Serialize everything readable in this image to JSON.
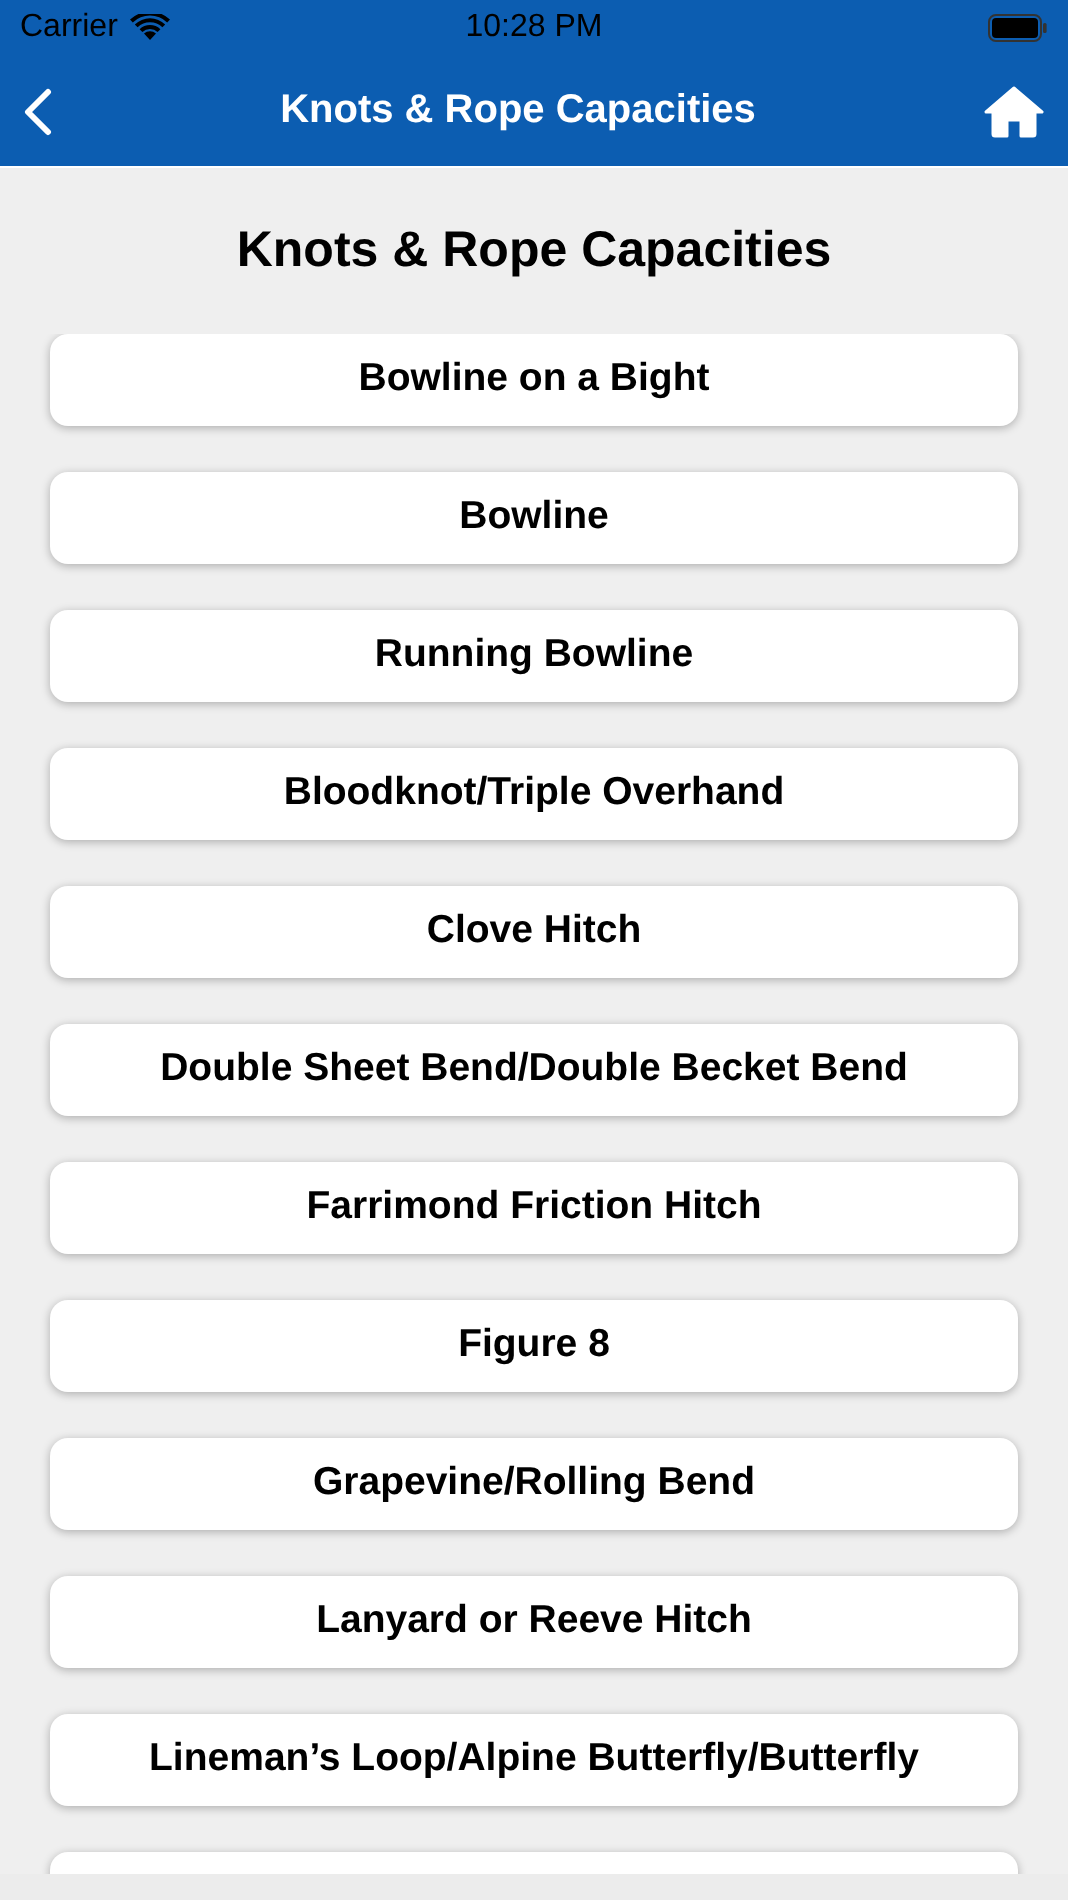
{
  "status_bar": {
    "carrier": "Carrier",
    "time": "10:28 PM"
  },
  "nav_bar": {
    "title": "Knots & Rope Capacities"
  },
  "heading": "Knots & Rope Capacities",
  "items": [
    {
      "label": "Bowline on a Bight"
    },
    {
      "label": "Bowline"
    },
    {
      "label": "Running Bowline"
    },
    {
      "label": "Bloodknot/Triple Overhand"
    },
    {
      "label": "Clove Hitch"
    },
    {
      "label": "Double Sheet Bend/Double Becket Bend"
    },
    {
      "label": "Farrimond Friction Hitch"
    },
    {
      "label": "Figure 8"
    },
    {
      "label": "Grapevine/Rolling Bend"
    },
    {
      "label": "Lanyard or Reeve Hitch"
    },
    {
      "label": "Lineman’s Loop/Alpine Butterfly/Butterfly"
    }
  ]
}
